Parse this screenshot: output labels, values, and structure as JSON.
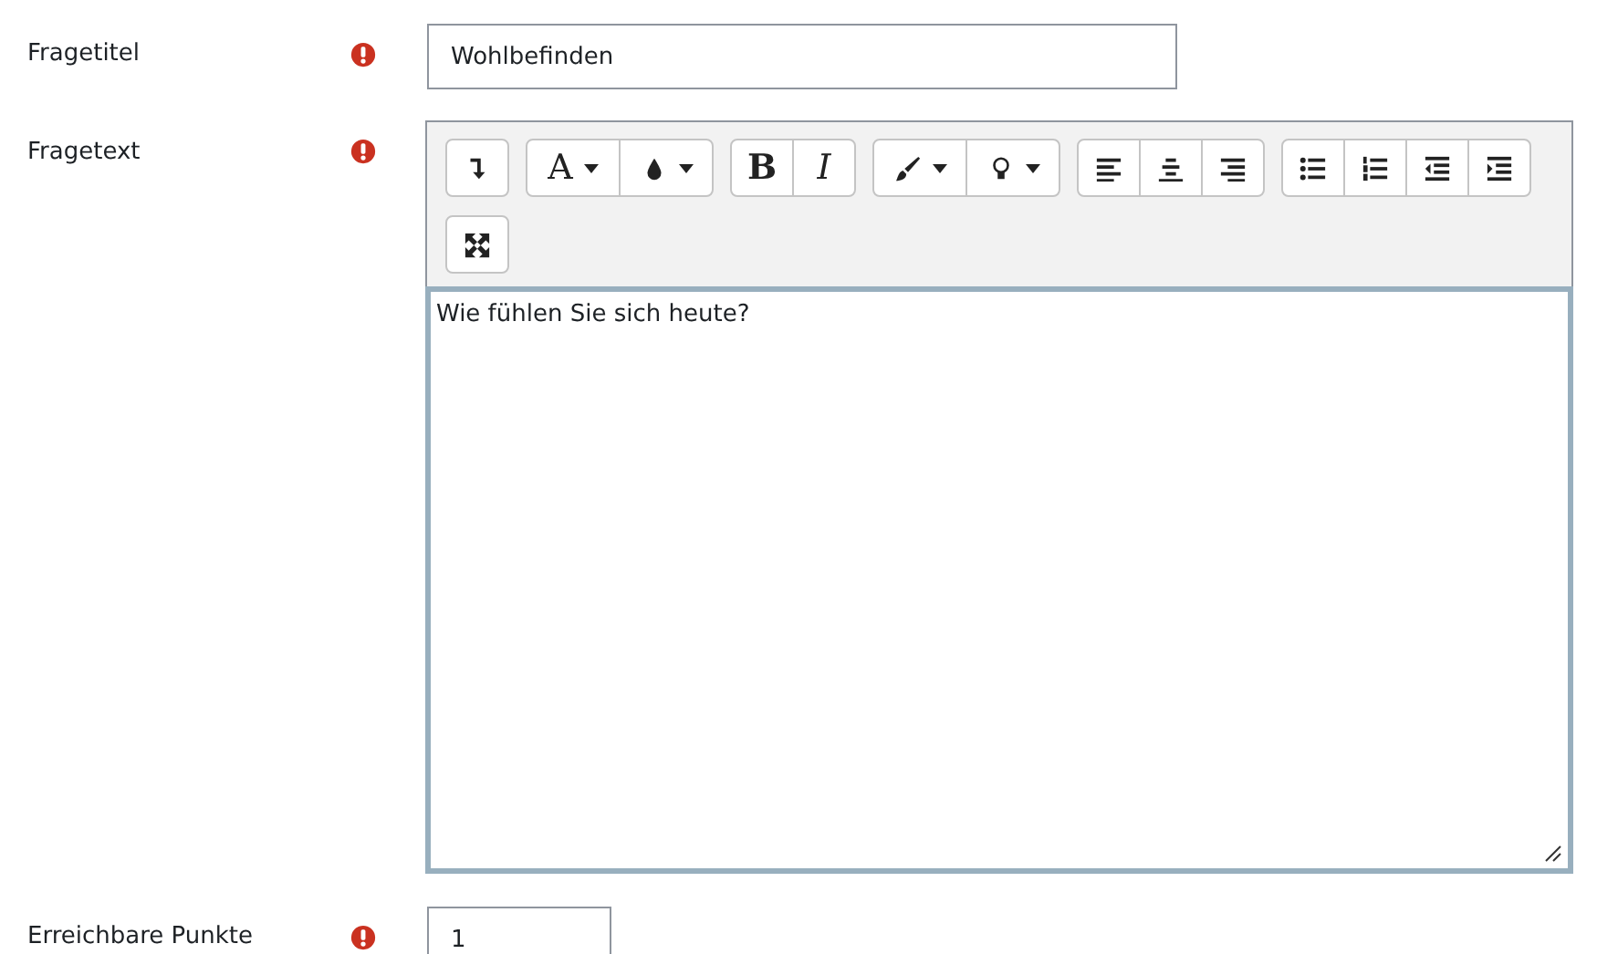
{
  "fields": [
    {
      "kind": "text",
      "label": "Fragetitel",
      "required": true,
      "value": "Wohlbefinden"
    },
    {
      "kind": "editor",
      "label": "Fragetext",
      "required": true,
      "value": "Wie fühlen Sie sich heute?",
      "toolbar": [
        [
          {
            "kind": "collapse"
          }
        ],
        [
          {
            "kind": "text",
            "label": "A",
            "dropdown": true
          },
          {
            "kind": "drop",
            "dropdown": true
          }
        ],
        [
          {
            "kind": "bold",
            "label": "B"
          },
          {
            "kind": "italic",
            "label": "I"
          }
        ],
        [
          {
            "kind": "brush",
            "dropdown": true
          },
          {
            "kind": "bulb",
            "dropdown": true
          }
        ],
        [
          {
            "kind": "alignleft"
          },
          {
            "kind": "aligncenter"
          },
          {
            "kind": "alignright"
          }
        ],
        [
          {
            "kind": "bullets"
          },
          {
            "kind": "numbers"
          },
          {
            "kind": "outdent"
          },
          {
            "kind": "indent"
          }
        ],
        [
          {
            "kind": "fullscreen"
          }
        ]
      ]
    },
    {
      "kind": "short",
      "label": "Erreichbare Punkte",
      "required": true,
      "value": "1"
    }
  ]
}
